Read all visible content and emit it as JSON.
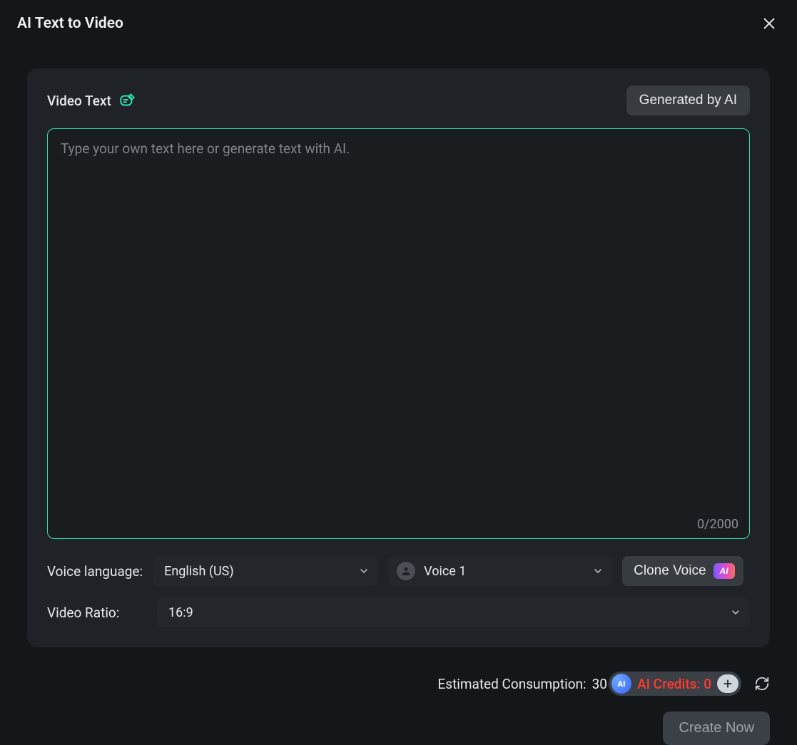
{
  "modal": {
    "title": "AI Text to Video"
  },
  "card": {
    "video_text_label": "Video Text",
    "generated_by_ai": "Generated by AI",
    "placeholder": "Type your own text here or generate text with AI.",
    "char_count": "0/2000",
    "voice_language_label": "Voice language:",
    "voice_language_value": "English (US)",
    "voice_value": "Voice 1",
    "clone_voice_label": "Clone Voice",
    "ai_badge": "AI",
    "video_ratio_label": "Video Ratio:",
    "video_ratio_value": "16:9"
  },
  "footer": {
    "estimated_label": "Estimated Consumption: ",
    "estimated_value": "30",
    "ai_star_label": "AI",
    "credits_text": "AI Credits: 0",
    "create_now": "Create Now"
  }
}
